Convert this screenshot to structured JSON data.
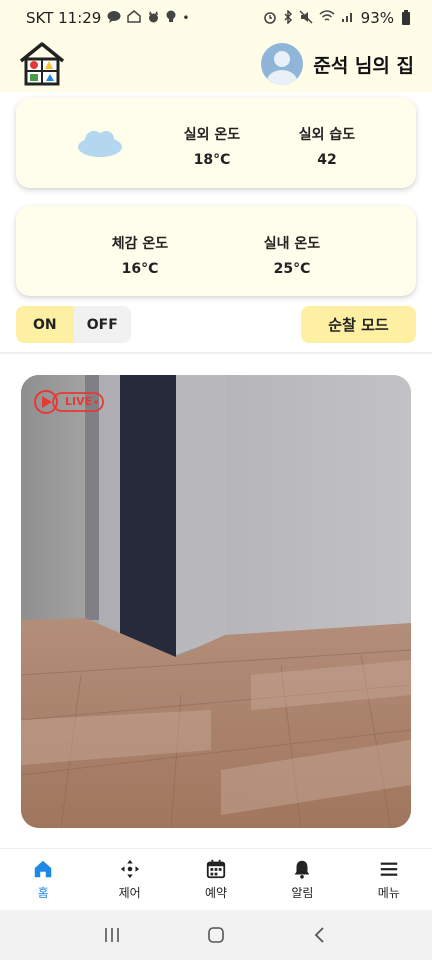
{
  "status_bar": {
    "carrier_time": "SKT 11:29",
    "battery": "93%",
    "left_icons": [
      "talk-icon",
      "home-app-icon",
      "cat-icon",
      "bulb-icon",
      "dot-icon"
    ],
    "right_icons": [
      "alarm-icon",
      "bluetooth-icon",
      "mute-icon",
      "wifi-icon",
      "signal-icon",
      "battery-icon"
    ]
  },
  "header": {
    "user_name": "준석 님의 집"
  },
  "weather": {
    "icon": "cloud-icon",
    "outdoor_temp_label": "실외 온도",
    "outdoor_temp_value": "18°C",
    "outdoor_humidity_label": "실외 습도",
    "outdoor_humidity_value": "42"
  },
  "temperature": {
    "feels_like_label": "체감 온도",
    "feels_like_value": "16°C",
    "indoor_temp_label": "실내 온도",
    "indoor_temp_value": "25°C"
  },
  "controls": {
    "on_label": "ON",
    "off_label": "OFF",
    "patrol_mode_label": "순찰 모드"
  },
  "camera": {
    "live_label": "LIVE"
  },
  "bottom_nav": {
    "items": [
      {
        "label": "홈",
        "icon": "home-icon",
        "active": true
      },
      {
        "label": "제어",
        "icon": "dpad-icon",
        "active": false
      },
      {
        "label": "예약",
        "icon": "calendar-icon",
        "active": false
      },
      {
        "label": "알림",
        "icon": "bell-icon",
        "active": false
      },
      {
        "label": "메뉴",
        "icon": "menu-icon",
        "active": false
      }
    ]
  },
  "colors": {
    "header_bg": "#fffde8",
    "card_bg": "#fffdeb",
    "accent_yellow": "#fdf0a3",
    "active_blue": "#1e88e5",
    "live_red": "#e53935"
  }
}
